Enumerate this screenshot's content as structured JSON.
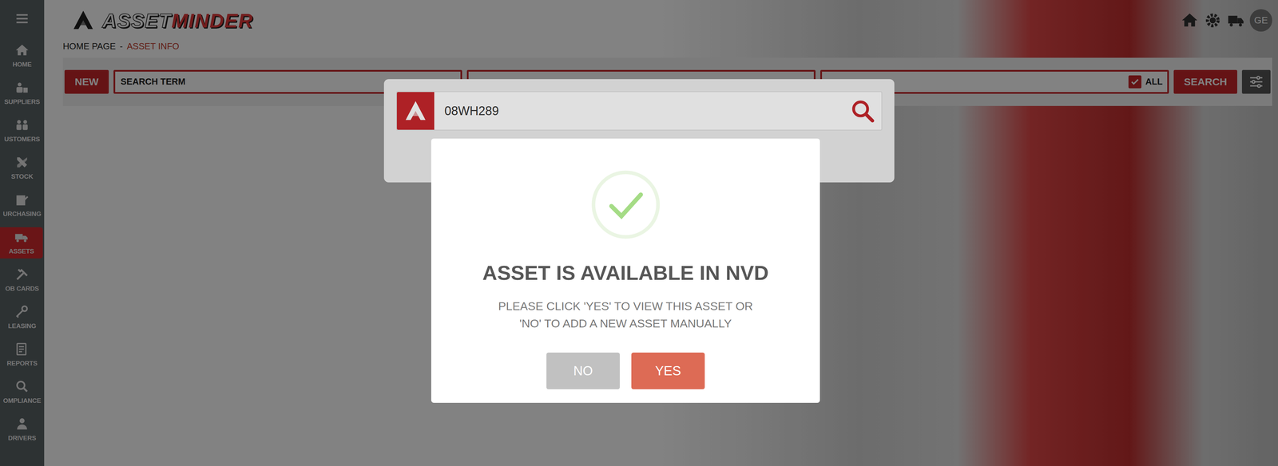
{
  "app": {
    "logo_part1": "ASSET",
    "logo_part2": "MINDER",
    "avatar": "GE"
  },
  "sidebar": {
    "items": [
      {
        "label": "HOME",
        "selected": false
      },
      {
        "label": "SUPPLIERS",
        "selected": false
      },
      {
        "label": "USTOMERS",
        "selected": false
      },
      {
        "label": "STOCK",
        "selected": false
      },
      {
        "label": "URCHASING",
        "selected": false
      },
      {
        "label": "ASSETS",
        "selected": true
      },
      {
        "label": "OB CARDS",
        "selected": false
      },
      {
        "label": "LEASING",
        "selected": false
      },
      {
        "label": "REPORTS",
        "selected": false
      },
      {
        "label": "OMPLIANCE",
        "selected": false
      },
      {
        "label": "DRIVERS",
        "selected": false
      }
    ]
  },
  "breadcrumb": {
    "items": [
      "HOME PAGE",
      "ASSET INFO"
    ],
    "separator": "-"
  },
  "toolbar": {
    "new_button": "NEW",
    "search_placeholder": "SEARCH TERM",
    "all_checkbox": {
      "label": "ALL",
      "checked": true
    },
    "search_button": "SEARCH"
  },
  "search_dialog": {
    "value": "08WH289"
  },
  "alert": {
    "title": "ASSET IS AVAILABLE IN NVD",
    "message_lines": [
      "PLEASE CLICK 'YES' TO VIEW THIS ASSET OR",
      "'NO' TO ADD A NEW ASSET MANUALLY"
    ],
    "buttons": [
      {
        "label": "NO"
      },
      {
        "label": "YES"
      }
    ]
  }
}
